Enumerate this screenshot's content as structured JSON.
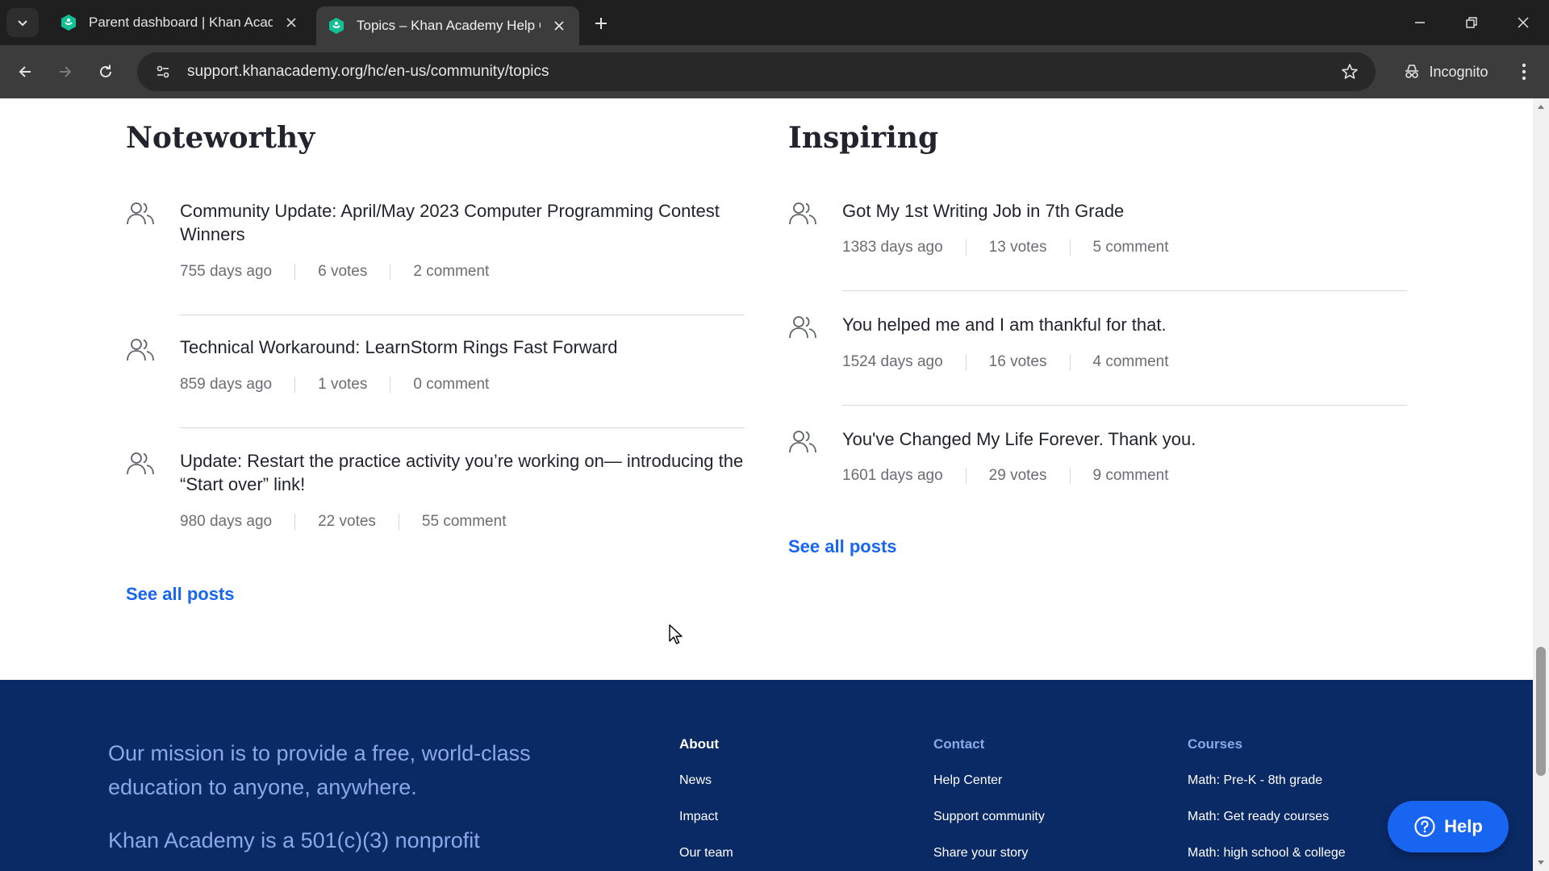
{
  "browser": {
    "tabs": [
      {
        "title": "Parent dashboard | Khan Academy",
        "active": false
      },
      {
        "title": "Topics – Khan Academy Help Center",
        "active": true
      }
    ],
    "url": "support.khanacademy.org/hc/en-us/community/topics",
    "profile_label": "Incognito"
  },
  "sections": {
    "noteworthy": {
      "title": "Noteworthy",
      "posts": [
        {
          "title": "Community Update: April/May 2023 Computer Programming Contest Winners",
          "age": "755 days ago",
          "votes": "6 votes",
          "comments": "2 comment"
        },
        {
          "title": "Technical Workaround: LearnStorm Rings Fast Forward",
          "age": "859 days ago",
          "votes": "1 votes",
          "comments": "0 comment"
        },
        {
          "title": "Update: Restart the practice activity you’re working on— introducing the “Start over” link!",
          "age": "980 days ago",
          "votes": "22 votes",
          "comments": "55 comment"
        }
      ],
      "see_all": "See all posts"
    },
    "inspiring": {
      "title": "Inspiring",
      "posts": [
        {
          "title": "Got My 1st Writing Job in 7th Grade",
          "age": "1383 days ago",
          "votes": "13 votes",
          "comments": "5 comment"
        },
        {
          "title": "You helped me and I am thankful for that.",
          "age": "1524 days ago",
          "votes": "16 votes",
          "comments": "4 comment"
        },
        {
          "title": "You've Changed My Life Forever. Thank you.",
          "age": "1601 days ago",
          "votes": "29 votes",
          "comments": "9 comment"
        }
      ],
      "see_all": "See all posts"
    }
  },
  "footer": {
    "mission": "Our mission is to provide a free, world-class education to anyone, anywhere.",
    "nonprofit": "Khan Academy is a 501(c)(3) nonprofit",
    "about": {
      "heading": "About",
      "links": [
        "News",
        "Impact",
        "Our team"
      ]
    },
    "contact": {
      "heading": "Contact",
      "links": [
        "Help Center",
        "Support community",
        "Share your story"
      ]
    },
    "courses": {
      "heading": "Courses",
      "links": [
        "Math: Pre-K - 8th grade",
        "Math: Get ready courses",
        "Math: high school & college"
      ]
    }
  },
  "help_button": "Help",
  "colors": {
    "link_blue": "#1865f2",
    "footer_bg": "#0a2a66",
    "favicon_green": "#14bf96"
  }
}
